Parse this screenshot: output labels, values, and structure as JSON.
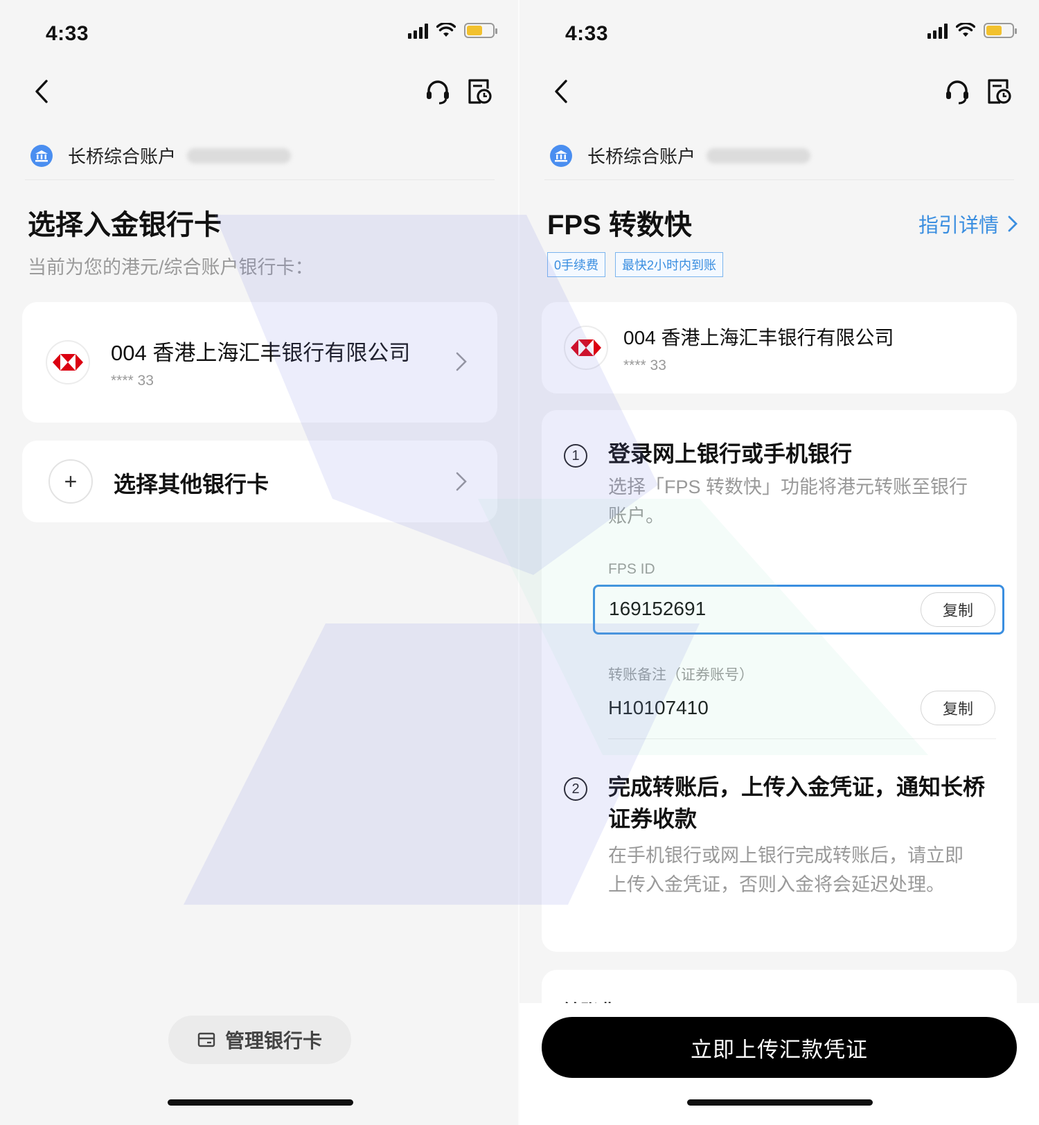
{
  "status_bar": {
    "time": "4:33"
  },
  "account": {
    "name": "长桥综合账户"
  },
  "left": {
    "title": "选择入金银行卡",
    "subtitle": "当前为您的港元/综合账户银行卡：",
    "bank_card": {
      "name": "004 香港上海汇丰银行有限公司",
      "number": "**** 33"
    },
    "other_card_label": "选择其他银行卡",
    "manage_button": "管理银行卡"
  },
  "right": {
    "title": "FPS 转数快",
    "guide_link": "指引详情",
    "tags": [
      "0手续费",
      "最快2小时内到账"
    ],
    "bank_card": {
      "name": "004 香港上海汇丰银行有限公司",
      "number": "**** 33"
    },
    "step1": {
      "num": "1",
      "title": "登录网上银行或手机银行",
      "desc_line1": "选择「FPS 转数快」功能将港元转账至银行",
      "desc_line2": "账户。"
    },
    "fps_id": {
      "label": "FPS ID",
      "value": "169152691",
      "copy": "复制"
    },
    "remark": {
      "label": "转账备注（证券账号）",
      "value": "H10107410",
      "copy": "复制"
    },
    "step2": {
      "num": "2",
      "title_line1": "完成转账后，上传入金凭证，通知长桥",
      "title_line2": "证券收款",
      "desc_line1": "在手机银行或网上银行完成转账后，请立即",
      "desc_line2": "上传入金凭证，否则入金将会延迟处理。"
    },
    "partial_section": "转账费用",
    "upload_button": "立即上传汇款凭证"
  },
  "icons": {
    "back": "chevron-left-icon",
    "support": "headset-icon",
    "history": "records-clock-icon",
    "bank": "bank-icon",
    "hsbc": "hsbc-logo",
    "plus": "plus-icon",
    "card": "card-icon",
    "chevron": "chevron-right-icon"
  },
  "colors": {
    "accent": "#3a8ee0",
    "primary_button": "#000000",
    "hsbc_red": "#db0011"
  }
}
